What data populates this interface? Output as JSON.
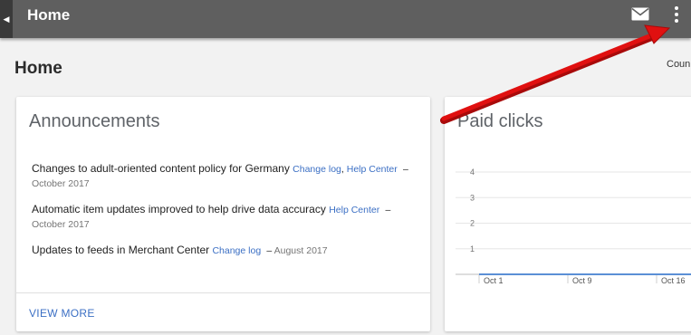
{
  "topbar": {
    "title": "Home",
    "back_icon": "triangle-left",
    "mail_icon": "envelope",
    "more_icon": "vertical-ellipsis"
  },
  "page": {
    "heading": "Home",
    "country_label": "Coun"
  },
  "announcements": {
    "title": "Announcements",
    "items": [
      {
        "text": "Changes to adult-oriented content policy for Germany",
        "links": [
          "Change log",
          "Help Center"
        ],
        "date": "October 2017"
      },
      {
        "text": "Automatic item updates improved to help drive data accuracy",
        "links": [
          "Help Center"
        ],
        "date": "October 2017"
      },
      {
        "text": "Updates to feeds in Merchant Center",
        "links": [
          "Change log"
        ],
        "date": "August 2017"
      }
    ],
    "view_more": "VIEW MORE"
  },
  "paid_clicks": {
    "title": "Paid clicks"
  },
  "chart_data": {
    "type": "line",
    "title": "Paid clicks",
    "xlabel": "",
    "ylabel": "",
    "y_ticks": [
      1,
      2,
      3,
      4
    ],
    "ylim": [
      0,
      4
    ],
    "x_tick_labels": [
      "Oct 1",
      "Oct 9",
      "Oct 16"
    ],
    "series": [
      {
        "values": [
          0,
          0,
          0
        ]
      }
    ],
    "grid": true,
    "line_color": "#5b8fd6"
  },
  "annotation": {
    "type": "red-arrow",
    "color": "#e01010",
    "points_to": "more-options-icon"
  }
}
